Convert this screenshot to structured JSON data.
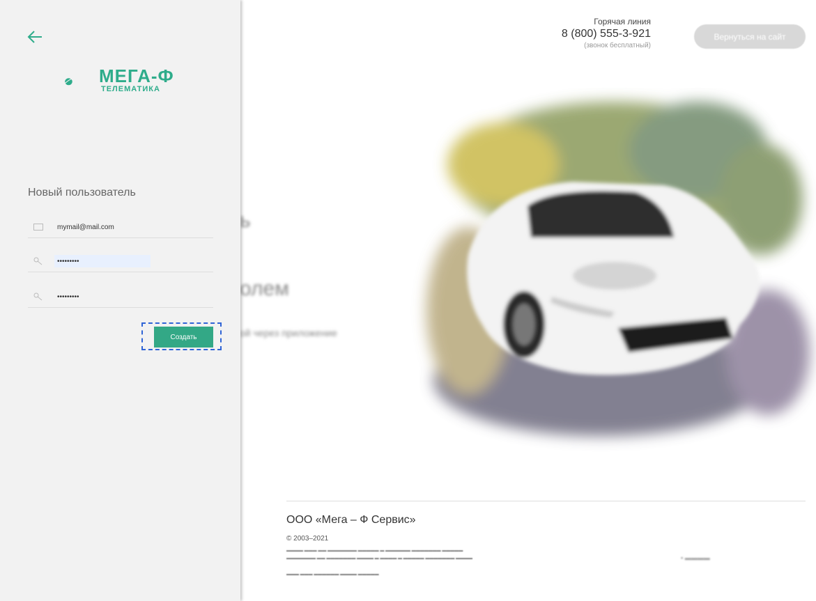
{
  "hotline": {
    "title": "Горячая линия",
    "phone": "8 (800) 555-3-921",
    "note": "(звонок бесплатный)"
  },
  "header": {
    "return_label": "Вернуться на сайт"
  },
  "footer": {
    "company": "ООО «Мега – Ф Сервис»",
    "copyright": "© 2003–2021"
  },
  "logo": {
    "title": "МЕГА-Ф",
    "subtitle": "ТЕЛЕМАТИКА"
  },
  "form": {
    "title": "Новый пользователь",
    "email_value": "mymail@mail.com",
    "password_value": "•••••••••",
    "confirm_value": "•••••••••",
    "create_label": "Создать"
  },
  "colors": {
    "brand": "#2eac8b",
    "button": "#33a886",
    "focus_frame": "#2f64d6"
  }
}
